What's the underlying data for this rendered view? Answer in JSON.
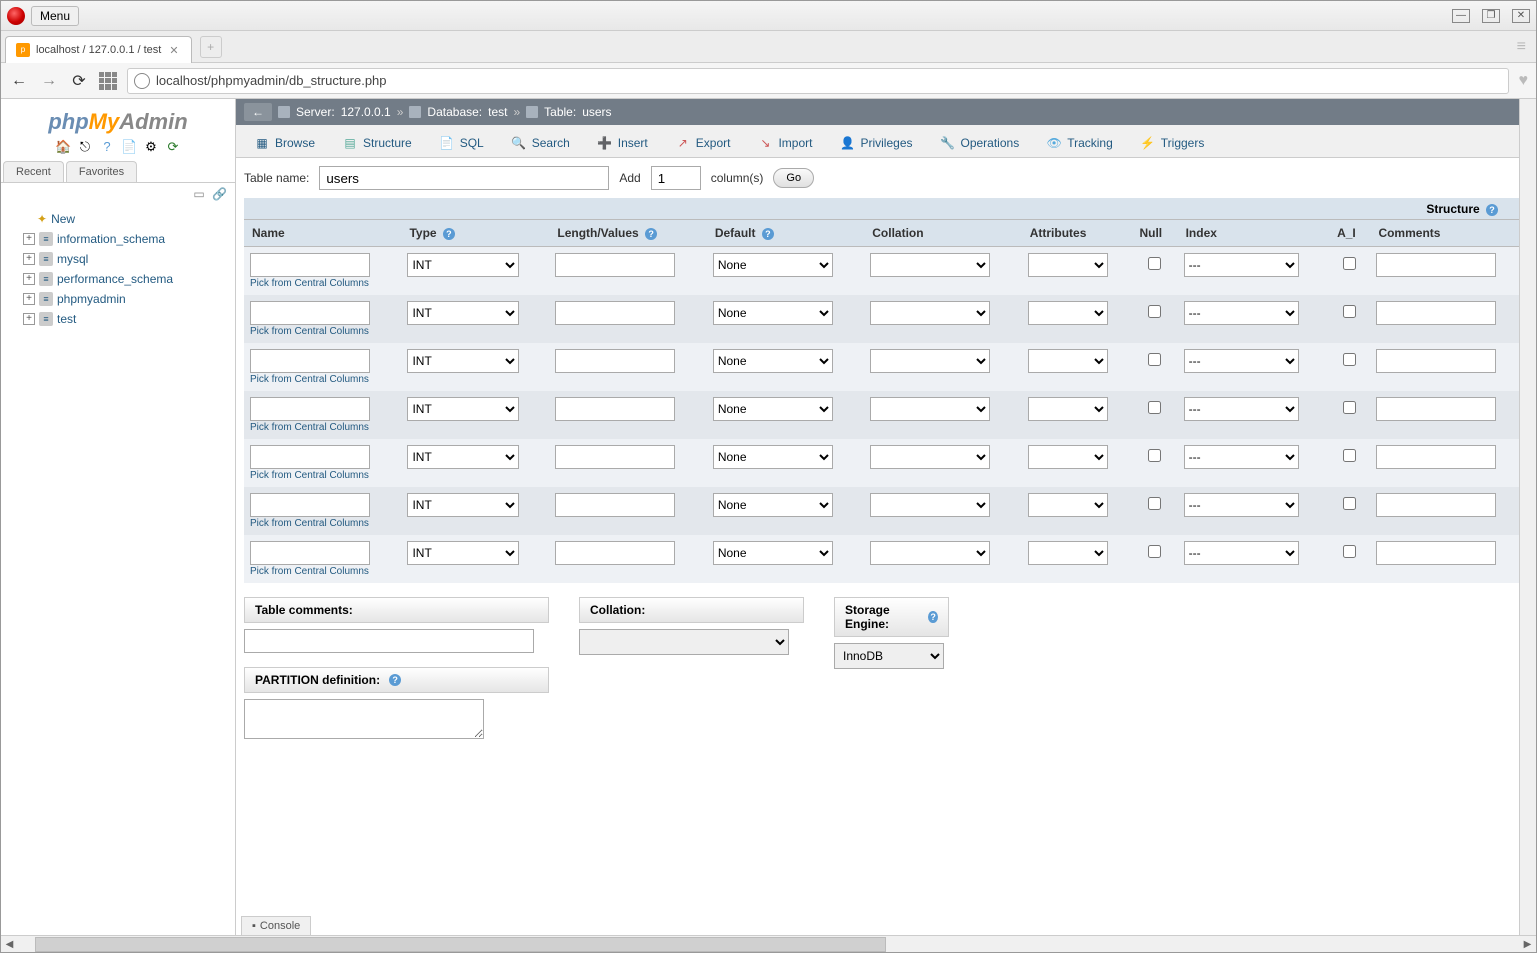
{
  "titlebar": {
    "menu": "Menu"
  },
  "browser_tab": {
    "title": "localhost / 127.0.0.1 / test"
  },
  "url": "localhost/phpmyadmin/db_structure.php",
  "logo": {
    "php": "php",
    "my": "My",
    "admin": "Admin"
  },
  "sidebar_tabs": {
    "recent": "Recent",
    "favorites": "Favorites"
  },
  "tree": {
    "new": "New",
    "dbs": [
      "information_schema",
      "mysql",
      "performance_schema",
      "phpmyadmin",
      "test"
    ]
  },
  "breadcrumb": {
    "server_label": "Server:",
    "server_val": "127.0.0.1",
    "db_label": "Database:",
    "db_val": "test",
    "table_label": "Table:",
    "table_val": "users"
  },
  "tabs": {
    "browse": "Browse",
    "structure": "Structure",
    "sql": "SQL",
    "search": "Search",
    "insert": "Insert",
    "export": "Export",
    "import": "Import",
    "privileges": "Privileges",
    "operations": "Operations",
    "tracking": "Tracking",
    "triggers": "Triggers"
  },
  "form": {
    "table_name_label": "Table name:",
    "table_name_value": "users",
    "add_label": "Add",
    "add_count": "1",
    "columns_label": "column(s)",
    "go": "Go"
  },
  "headers": {
    "structure": "Structure",
    "name": "Name",
    "type": "Type",
    "length": "Length/Values",
    "default": "Default",
    "collation": "Collation",
    "attributes": "Attributes",
    "null": "Null",
    "index": "Index",
    "ai": "A_I",
    "comments": "Comments"
  },
  "row_defaults": {
    "type": "INT",
    "default": "None",
    "index": "---",
    "pick": "Pick from Central Columns"
  },
  "bottom": {
    "table_comments": "Table comments:",
    "collation": "Collation:",
    "storage_engine": "Storage Engine:",
    "storage_engine_value": "InnoDB",
    "partition": "PARTITION definition:"
  },
  "console": "Console"
}
